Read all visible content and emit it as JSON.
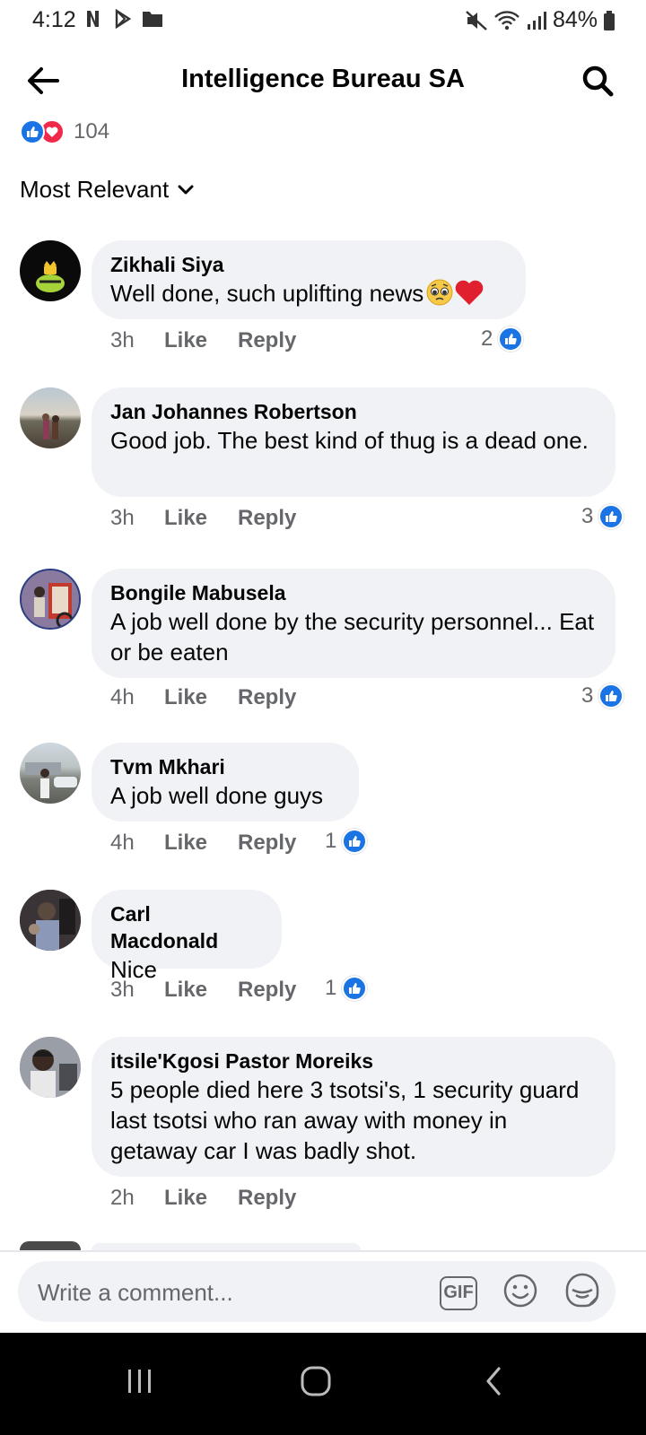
{
  "status_bar": {
    "time": "4:12",
    "battery": "84%"
  },
  "header": {
    "title": "Intelligence Bureau SA"
  },
  "reactions": {
    "count": "104"
  },
  "sort": {
    "label": "Most Relevant"
  },
  "comments": [
    {
      "name": "Zikhali Siya",
      "text": "Well done, such uplifting news",
      "time": "3h",
      "like": "Like",
      "reply": "Reply",
      "likes": "2"
    },
    {
      "name": "Jan Johannes Robertson",
      "text": "Good job. The best kind of thug is a dead one.",
      "time": "3h",
      "like": "Like",
      "reply": "Reply",
      "likes": "3"
    },
    {
      "name": "Bongile Mabusela",
      "text": "A job well done by the security personnel... Eat or be eaten",
      "time": "4h",
      "like": "Like",
      "reply": "Reply",
      "likes": "3"
    },
    {
      "name": "Tvm Mkhari",
      "text": "A job well done guys",
      "time": "4h",
      "like": "Like",
      "reply": "Reply",
      "likes": "1"
    },
    {
      "name": "Carl Macdonald",
      "text": "Nice",
      "time": "3h",
      "like": "Like",
      "reply": "Reply",
      "likes": "1"
    },
    {
      "name": "itsile'Kgosi Pastor Moreiks",
      "text": "5 people died here 3 tsotsi's, 1 security guard last tsotsi who ran away with money in getaway car I was badly shot.",
      "time": "2h",
      "like": "Like",
      "reply": "Reply"
    }
  ],
  "composer": {
    "placeholder": "Write a comment...",
    "gif_label": "GIF"
  },
  "colors": {
    "accent": "#1b74e4",
    "love": "#f0284a",
    "bubble": "#f0f2f5",
    "muted": "#65676b"
  },
  "icons": [
    "back-arrow-icon",
    "search-icon",
    "like-icon",
    "love-icon",
    "chevron-down-icon",
    "gif-icon",
    "emoji-icon",
    "sticker-icon",
    "recents-icon",
    "home-icon",
    "back-icon"
  ]
}
